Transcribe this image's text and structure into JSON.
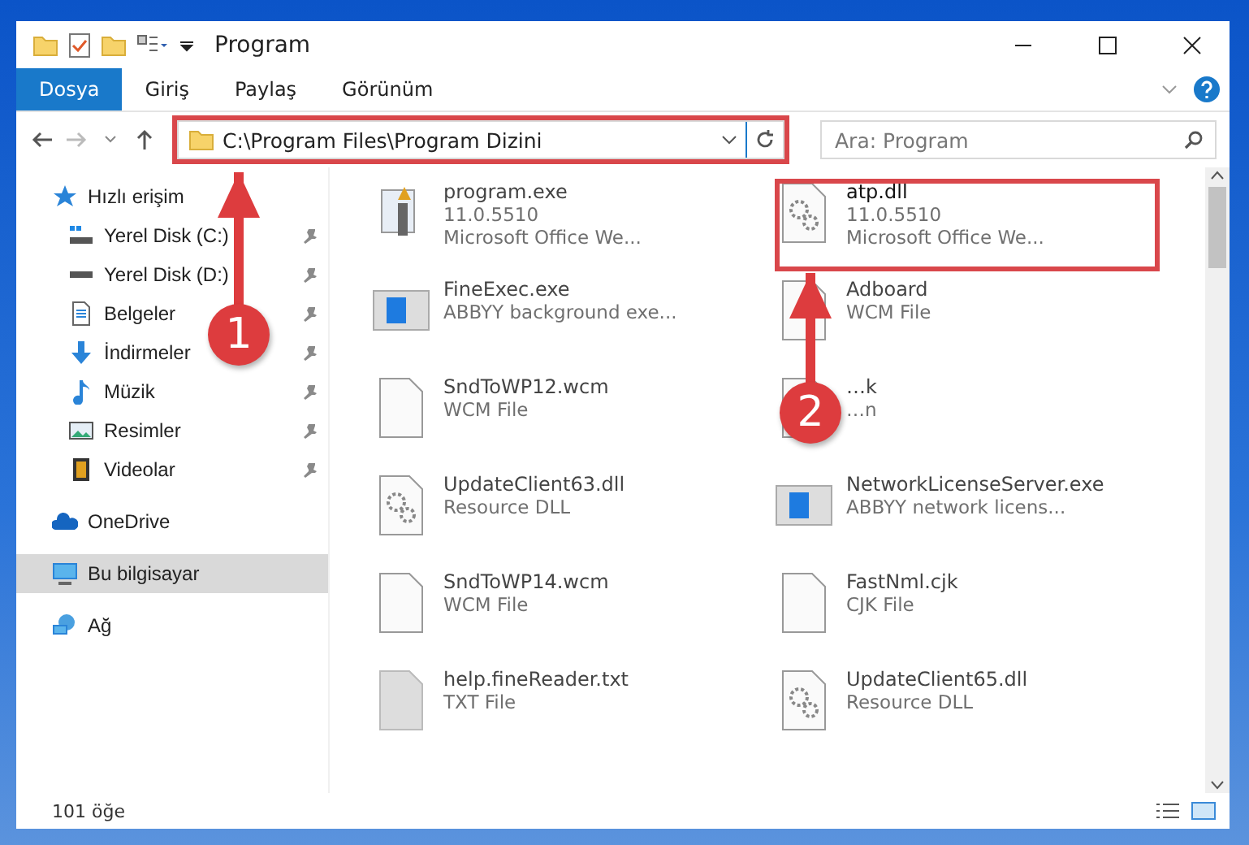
{
  "window": {
    "title": "Program"
  },
  "ribbon_tabs": [
    {
      "label": "Dosya",
      "selected": true
    },
    {
      "label": "Giriş",
      "selected": false
    },
    {
      "label": "Paylaş",
      "selected": false
    },
    {
      "label": "Görünüm",
      "selected": false
    }
  ],
  "address": {
    "path": "C:\\Program Files\\Program Dizini",
    "highlighted": true
  },
  "search": {
    "placeholder": "Ara: Program"
  },
  "sidebar": {
    "items": [
      {
        "label": "Hızlı erişim",
        "kind": "star",
        "selected": false,
        "children": [
          {
            "label": "Yerel Disk (C:)",
            "kind": "diskc",
            "pinned": true,
            "selected": false
          },
          {
            "label": "Yerel Disk (D:)",
            "kind": "disk",
            "pinned": true,
            "selected": false
          },
          {
            "label": "Belgeler",
            "kind": "docs",
            "pinned": true,
            "selected": false
          },
          {
            "label": "İndirmeler",
            "kind": "download",
            "pinned": true,
            "selected": false
          },
          {
            "label": "Müzik",
            "kind": "music",
            "pinned": true,
            "selected": false
          },
          {
            "label": "Resimler",
            "kind": "pictures",
            "pinned": true,
            "selected": false
          },
          {
            "label": "Videolar",
            "kind": "videos",
            "pinned": true,
            "selected": false
          }
        ]
      },
      {
        "label": "OneDrive",
        "kind": "cloud",
        "selected": false
      },
      {
        "label": "Bu bilgisayar",
        "kind": "pc",
        "selected": true
      },
      {
        "label": "Ağ",
        "kind": "network",
        "selected": false
      }
    ]
  },
  "files": [
    {
      "name": "program.exe",
      "details": [
        "11.0.5510",
        "Microsoft Office We..."
      ],
      "kind": "installer",
      "highlighted": false
    },
    {
      "name": "atp.dll",
      "details": [
        "11.0.5510",
        "Microsoft Office We..."
      ],
      "kind": "dll",
      "highlighted": true
    },
    {
      "name": "FineExec.exe",
      "details": [
        "ABBYY background exe..."
      ],
      "kind": "app",
      "highlighted": false
    },
    {
      "name": "Adboard",
      "details": [
        "WCM File"
      ],
      "kind": "doc",
      "highlighted": false
    },
    {
      "name": "SndToWP12.wcm",
      "details": [
        "WCM File"
      ],
      "kind": "doc",
      "highlighted": false
    },
    {
      "name": "…k",
      "details": [
        "…n"
      ],
      "kind": "doc",
      "highlighted": false
    },
    {
      "name": "UpdateClient63.dll",
      "details": [
        "Resource DLL"
      ],
      "kind": "dll",
      "highlighted": false
    },
    {
      "name": "NetworkLicenseServer.exe",
      "details": [
        "ABBYY network licens..."
      ],
      "kind": "app",
      "highlighted": false
    },
    {
      "name": "SndToWP14.wcm",
      "details": [
        "WCM File"
      ],
      "kind": "doc",
      "highlighted": false
    },
    {
      "name": "FastNml.cjk",
      "details": [
        "CJK File"
      ],
      "kind": "doc",
      "highlighted": false
    },
    {
      "name": "help.fineReader.txt",
      "details": [
        "TXT File"
      ],
      "kind": "txt",
      "highlighted": false
    },
    {
      "name": "UpdateClient65.dll",
      "details": [
        "Resource DLL"
      ],
      "kind": "dll",
      "highlighted": false
    }
  ],
  "annotations": [
    {
      "number": "1"
    },
    {
      "number": "2"
    }
  ],
  "status_bar": {
    "count": "101 öğe"
  }
}
